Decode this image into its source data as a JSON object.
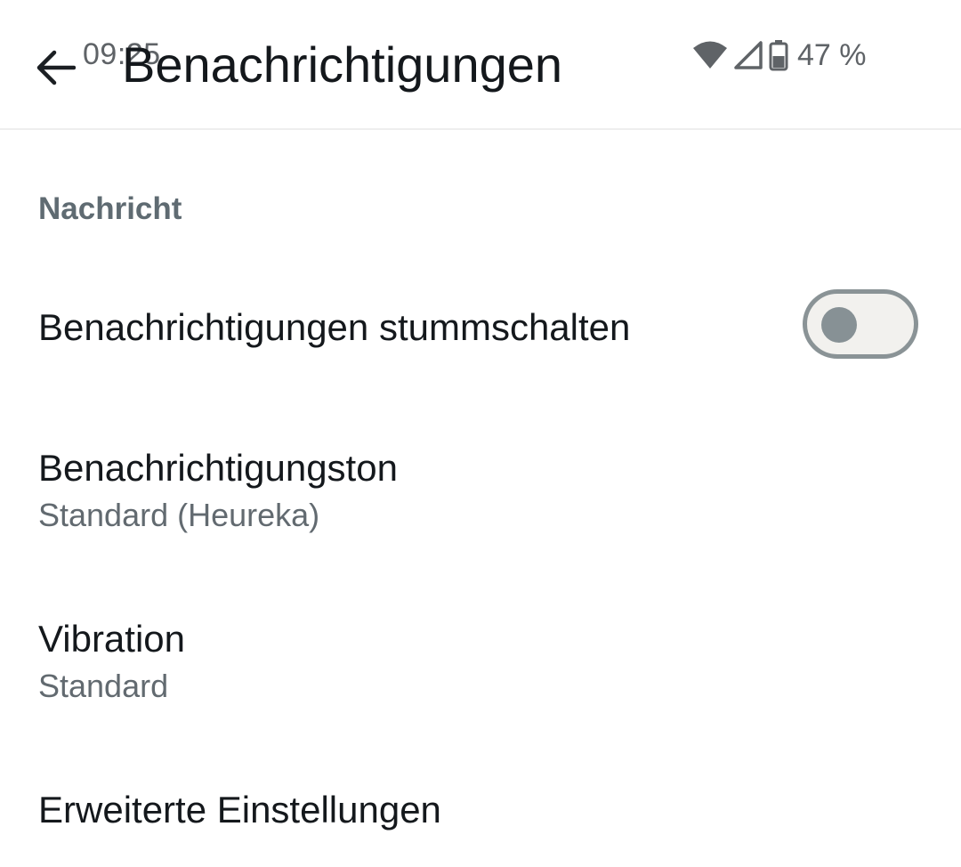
{
  "status_bar": {
    "time": "09:25",
    "battery": "47 %"
  },
  "header": {
    "title": "Benachrichtigungen"
  },
  "section": {
    "title": "Nachricht"
  },
  "settings": {
    "mute": {
      "title": "Benachrichtigungen stummschalten",
      "enabled": false
    },
    "sound": {
      "title": "Benachrichtigungston",
      "value": "Standard (Heureka)"
    },
    "vibration": {
      "title": "Vibration",
      "value": "Standard"
    },
    "advanced": {
      "title": "Erweiterte Einstellungen"
    }
  },
  "colors": {
    "toggle_off_track": "#f2f1ee",
    "toggle_off_border": "#8a9396",
    "section_header": "#5f6b72"
  }
}
